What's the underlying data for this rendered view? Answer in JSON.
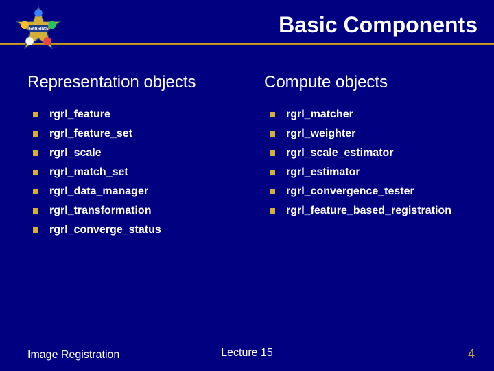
{
  "title": "Basic Components",
  "columns": [
    {
      "heading": "Representation objects",
      "items": [
        "rgrl_feature",
        "rgrl_feature_set",
        "rgrl_scale",
        "rgrl_match_set",
        "rgrl_data_manager",
        "rgrl_transformation",
        "rgrl_converge_status"
      ]
    },
    {
      "heading": "Compute objects",
      "items": [
        "rgrl_matcher",
        "rgrl_weighter",
        "rgrl_scale_estimator",
        "rgrl_estimator",
        "rgrl_convergence_tester",
        "rgrl_feature_based_registration"
      ]
    }
  ],
  "footer": {
    "left": "Image Registration",
    "center": "Lecture 15",
    "right": "4"
  }
}
